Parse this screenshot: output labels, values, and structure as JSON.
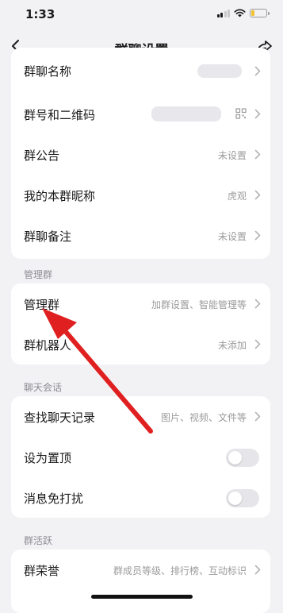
{
  "status_bar": {
    "time": "1:33"
  },
  "nav": {
    "title": "群聊设置"
  },
  "card_info": {
    "rows": [
      {
        "label": "群聊名称",
        "value": ""
      },
      {
        "label": "群号和二维码",
        "value": ""
      },
      {
        "label": "群公告",
        "value": "未设置"
      },
      {
        "label": "我的本群昵称",
        "value": "虎观"
      },
      {
        "label": "群聊备注",
        "value": "未设置"
      }
    ]
  },
  "section_manage": {
    "title": "管理群"
  },
  "card_manage": {
    "rows": [
      {
        "label": "管理群",
        "value": "加群设置、智能管理等"
      },
      {
        "label": "群机器人",
        "value": "未添加"
      }
    ]
  },
  "section_chat": {
    "title": "聊天会话"
  },
  "card_chat": {
    "rows": [
      {
        "label": "查找聊天记录",
        "value": "图片、视频、文件等"
      },
      {
        "label": "设为置顶",
        "toggle_on": false
      },
      {
        "label": "消息免打扰",
        "toggle_on": false
      }
    ]
  },
  "section_active": {
    "title": "群活跃"
  },
  "card_active": {
    "rows": [
      {
        "label": "群荣誉",
        "value": "群成员等级、排行榜、互动标识"
      }
    ]
  },
  "annotation": {
    "color": "#e02020",
    "icon": "red-arrow-pointer"
  },
  "colors": {
    "background": "#f2f2f5",
    "card": "#ffffff",
    "muted_text": "#9b9b9b",
    "toggle_off": "#e6e6ea"
  }
}
